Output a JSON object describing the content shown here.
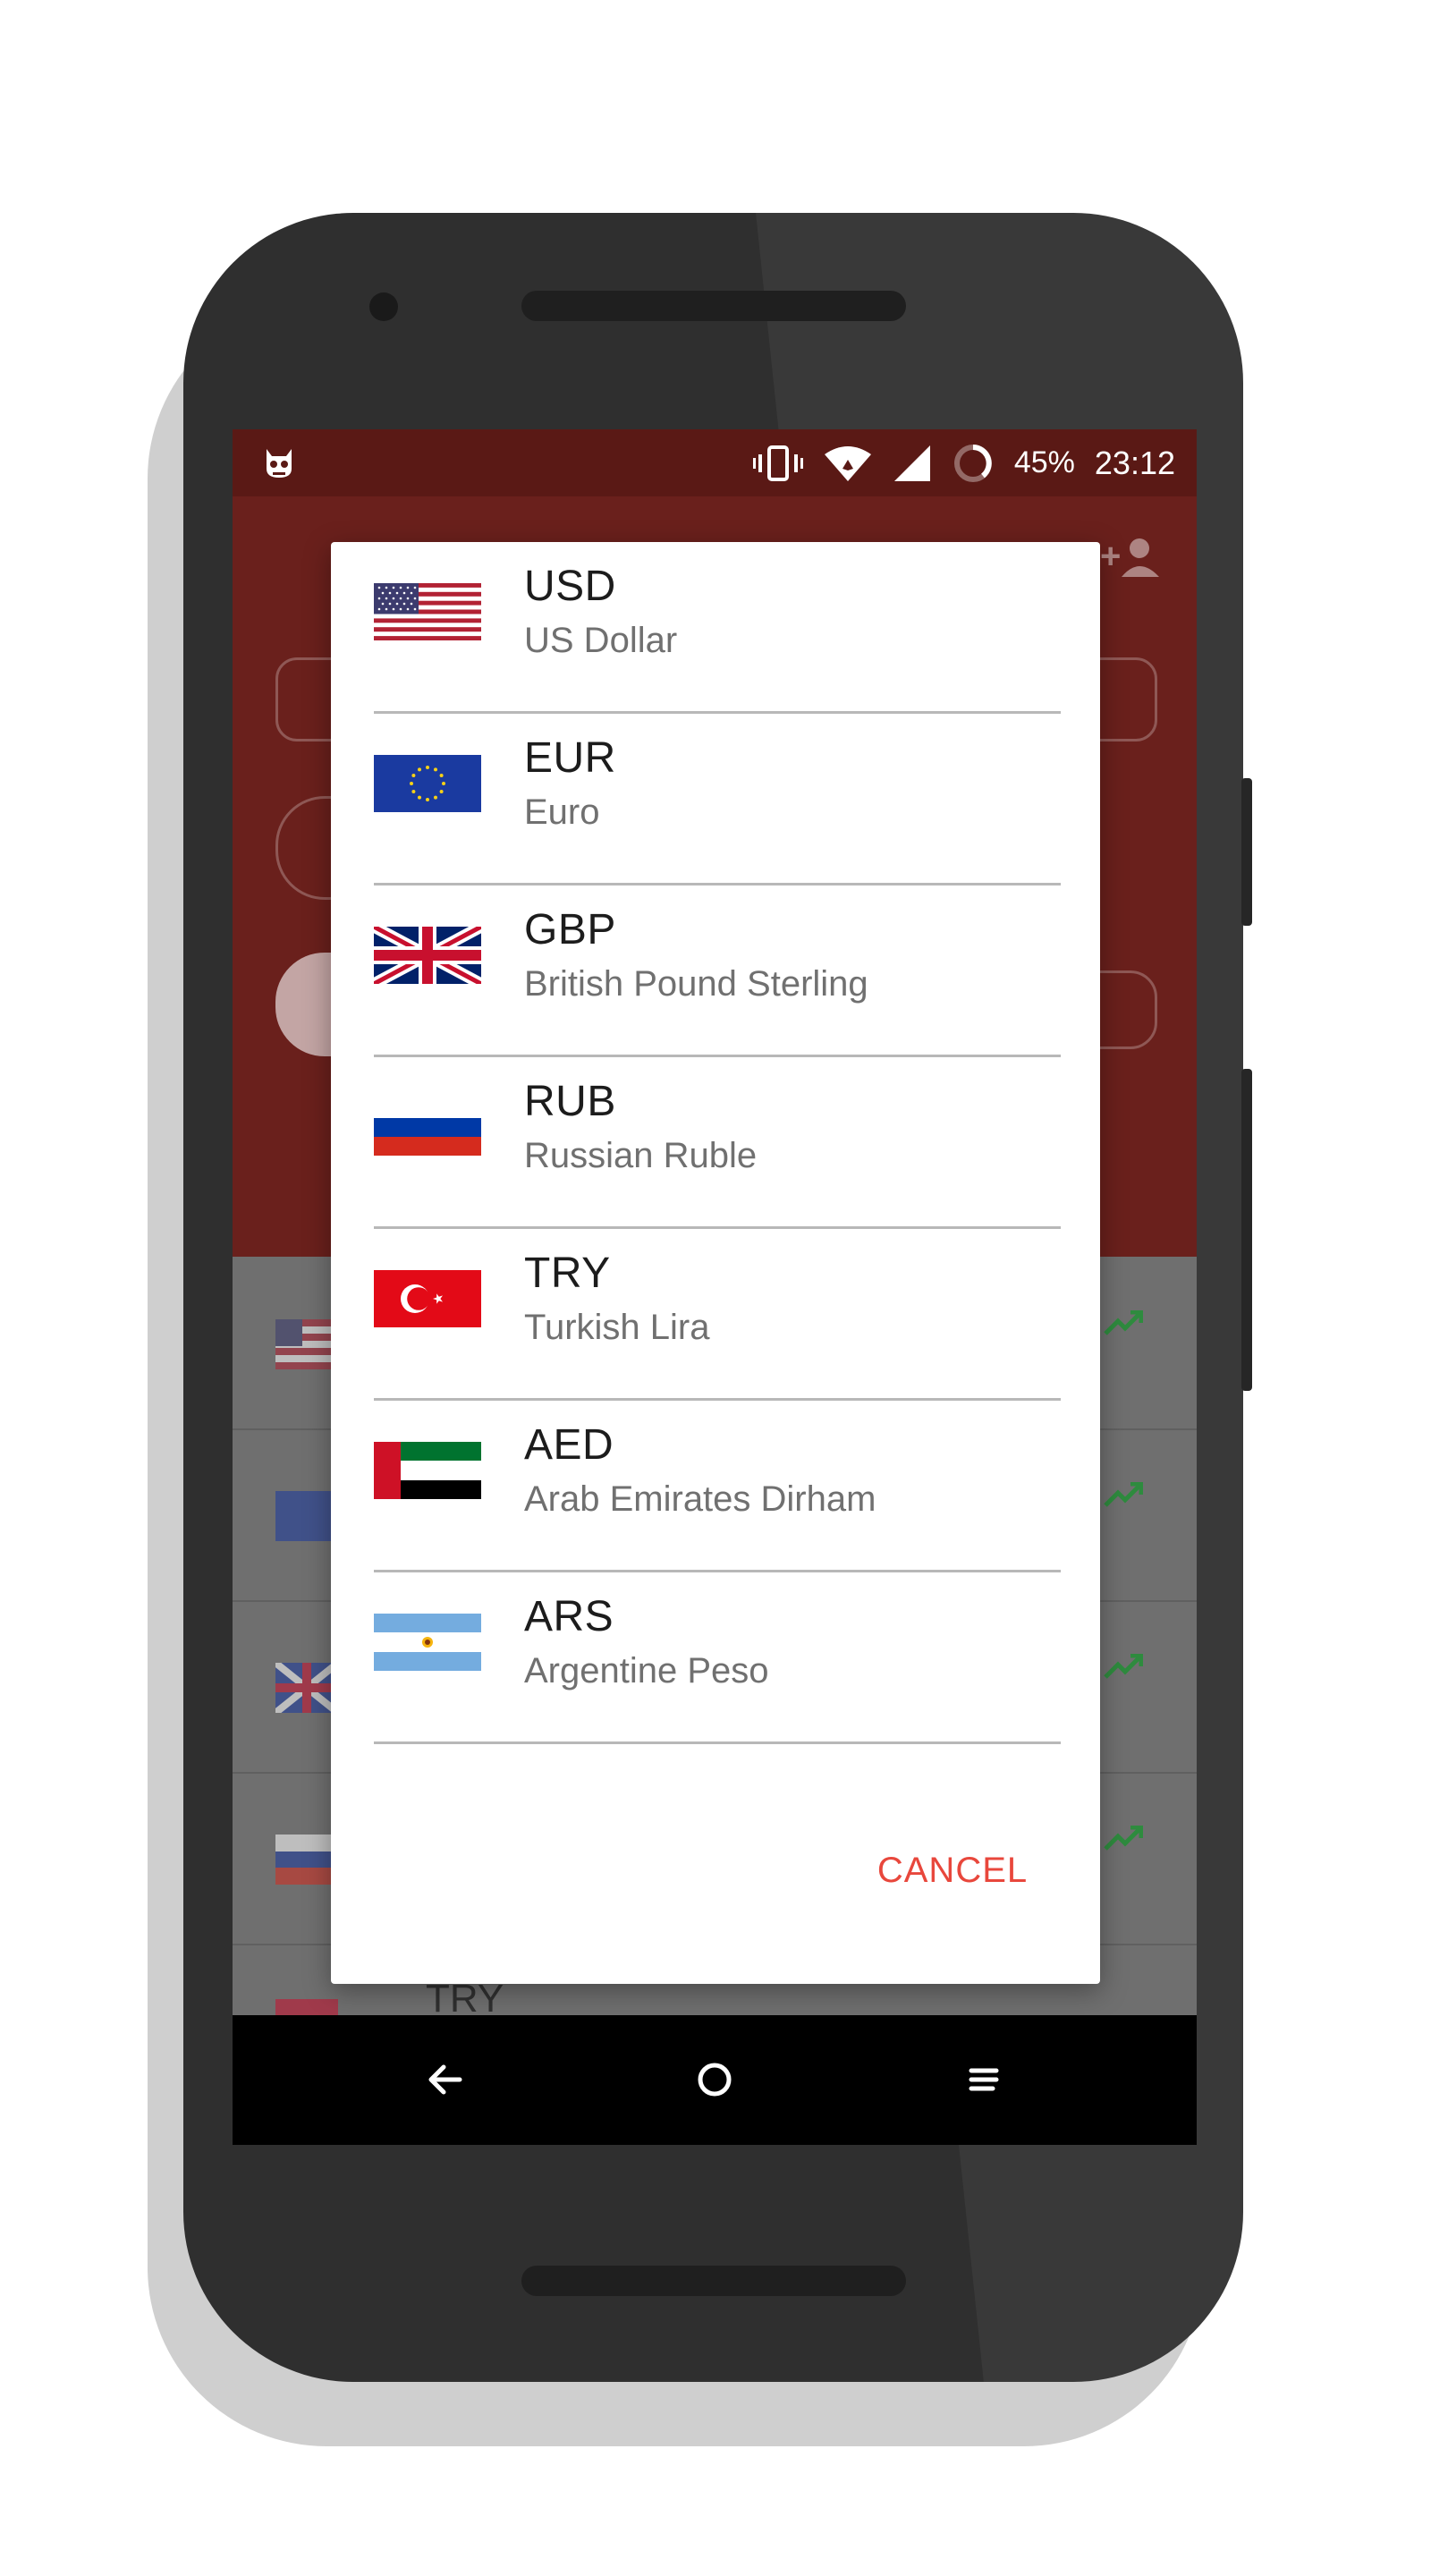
{
  "status_bar": {
    "battery_percent": "45%",
    "time": "23:12"
  },
  "dialog": {
    "currencies": [
      {
        "code": "USD",
        "name": "US Dollar",
        "flag_icon": "us-flag-icon"
      },
      {
        "code": "EUR",
        "name": "Euro",
        "flag_icon": "eu-flag-icon"
      },
      {
        "code": "GBP",
        "name": "British Pound Sterling",
        "flag_icon": "uk-flag-icon"
      },
      {
        "code": "RUB",
        "name": "Russian Ruble",
        "flag_icon": "russia-flag-icon"
      },
      {
        "code": "TRY",
        "name": "Turkish Lira",
        "flag_icon": "turkey-flag-icon"
      },
      {
        "code": "AED",
        "name": "Arab Emirates Dirham",
        "flag_icon": "uae-flag-icon"
      },
      {
        "code": "ARS",
        "name": "Argentine Peso",
        "flag_icon": "argentina-flag-icon"
      }
    ],
    "cancel_label": "CANCEL"
  },
  "background": {
    "partial_row_label": "TRY"
  },
  "colors": {
    "accent": "#e8473c",
    "header": "#6a201c",
    "status_bar": "#5a1915",
    "trend_up": "#2e8b3e"
  }
}
